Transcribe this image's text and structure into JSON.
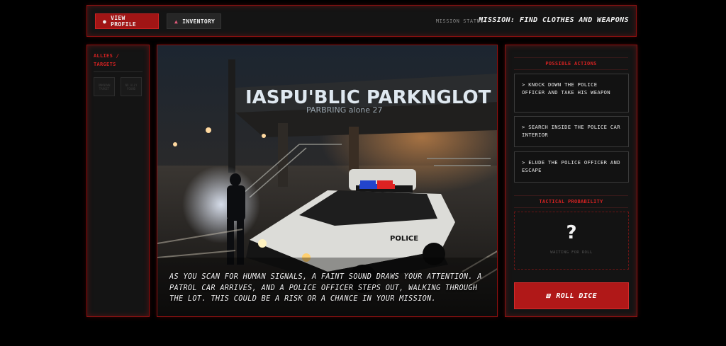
{
  "topbar": {
    "profile_label": "VIEW PROFILE",
    "profile_icon": "person-icon",
    "inventory_label": "INVENTORY",
    "inventory_icon": "bag-icon",
    "status_label": "MISSION STATUS:",
    "mission": "MISSION: FIND CLOTHES AND WEAPONS"
  },
  "left": {
    "title": "ALLIES / TARGETS",
    "slots": [
      "UNKNOWN TARGET",
      "NO ALLY FOUND"
    ]
  },
  "scene": {
    "sign_text": "IASPU'BLIC PARKNGLOT",
    "sub_sign_text": "PARBRING alone 27",
    "car_label": "POLICE",
    "narrative": "As you scan for human signals, a faint sound draws your attention. A patrol car arrives, and a police officer steps out, walking through the lot. This could be a risk or a chance in your mission."
  },
  "right": {
    "actions_title": "POSSIBLE ACTIONS",
    "actions": [
      "> KNOCK DOWN THE POLICE OFFICER AND TAKE HIS WEAPON",
      "> SEARCH INSIDE THE POLICE CAR INTERIOR",
      "> ELUDE THE POLICE OFFICER AND ESCAPE"
    ],
    "probability_title": "TACTICAL PROBABILITY",
    "probability_value": "?",
    "probability_status": "WAITING FOR ROLL",
    "roll_label": "ROLL DICE",
    "roll_icon": "dice-icon"
  },
  "colors": {
    "accent": "#b01818",
    "panel": "#141414",
    "border": "#8e1010"
  }
}
